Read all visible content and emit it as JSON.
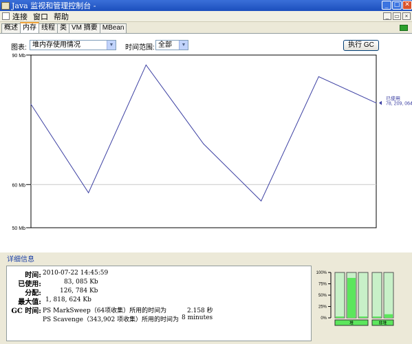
{
  "window": {
    "title": "Java 监视和管理控制台 -",
    "buttons": {
      "minimize": "_",
      "maximize": "□",
      "close": "✕"
    }
  },
  "menu": {
    "items": [
      "连接",
      "窗口",
      "帮助"
    ]
  },
  "tabs": [
    "概述",
    "内存",
    "线程",
    "类",
    "VM 摘要",
    "MBean"
  ],
  "active_tab": "内存",
  "controls": {
    "chart_label": "图表:",
    "chart_select": "堆内存使用情况",
    "time_label": "时间范围:",
    "time_select": "全部",
    "gc_button": "执行 GC"
  },
  "chart_data": {
    "type": "line",
    "title": "",
    "xlabel": "",
    "ylabel": "",
    "ylim": [
      50,
      90
    ],
    "yticks": [
      {
        "value": 90,
        "label": "90 Mb"
      },
      {
        "value": 60,
        "label": "60 Mb"
      },
      {
        "value": 50,
        "label": "50 Mb"
      }
    ],
    "grid_lines": [
      60
    ],
    "series": [
      {
        "values": [
          78.6,
          58.1,
          87.7,
          69.4,
          56.2,
          85.0,
          78.9
        ]
      }
    ],
    "legend_label": "已使用",
    "legend_value": "78, 209, 064",
    "line_color": "#3b3fa2"
  },
  "details": {
    "heading": "详细信息",
    "rows": [
      {
        "key": "时间:",
        "value": "2010-07-22 14:45:59"
      },
      {
        "key": "已使用:",
        "value": "83, 085 Kb"
      },
      {
        "key": "分配:",
        "value": "126, 784 Kb"
      },
      {
        "key": "最大值:",
        "value": "1, 818, 624 Kb"
      }
    ],
    "gc_key": "GC 时间:",
    "gc_rows": [
      {
        "name": "PS MarkSweep（64项收集）所用的时间为",
        "time": "2.158 秒"
      },
      {
        "name": "PS Scavenge（343,902 项收集）所用的时间为",
        "time": "8 minutes"
      }
    ]
  },
  "memory_bars": {
    "scale": [
      "100%",
      "75%",
      "50%",
      "25%",
      "0%"
    ],
    "group1_label": "堆",
    "group2_label": "非堆",
    "group1_fill": [
      0.03,
      0.88,
      0.03
    ],
    "group2_fill": [
      0.03,
      0.08
    ],
    "fill_color": "#5ce65c",
    "track_color": "#c8f0c8"
  }
}
